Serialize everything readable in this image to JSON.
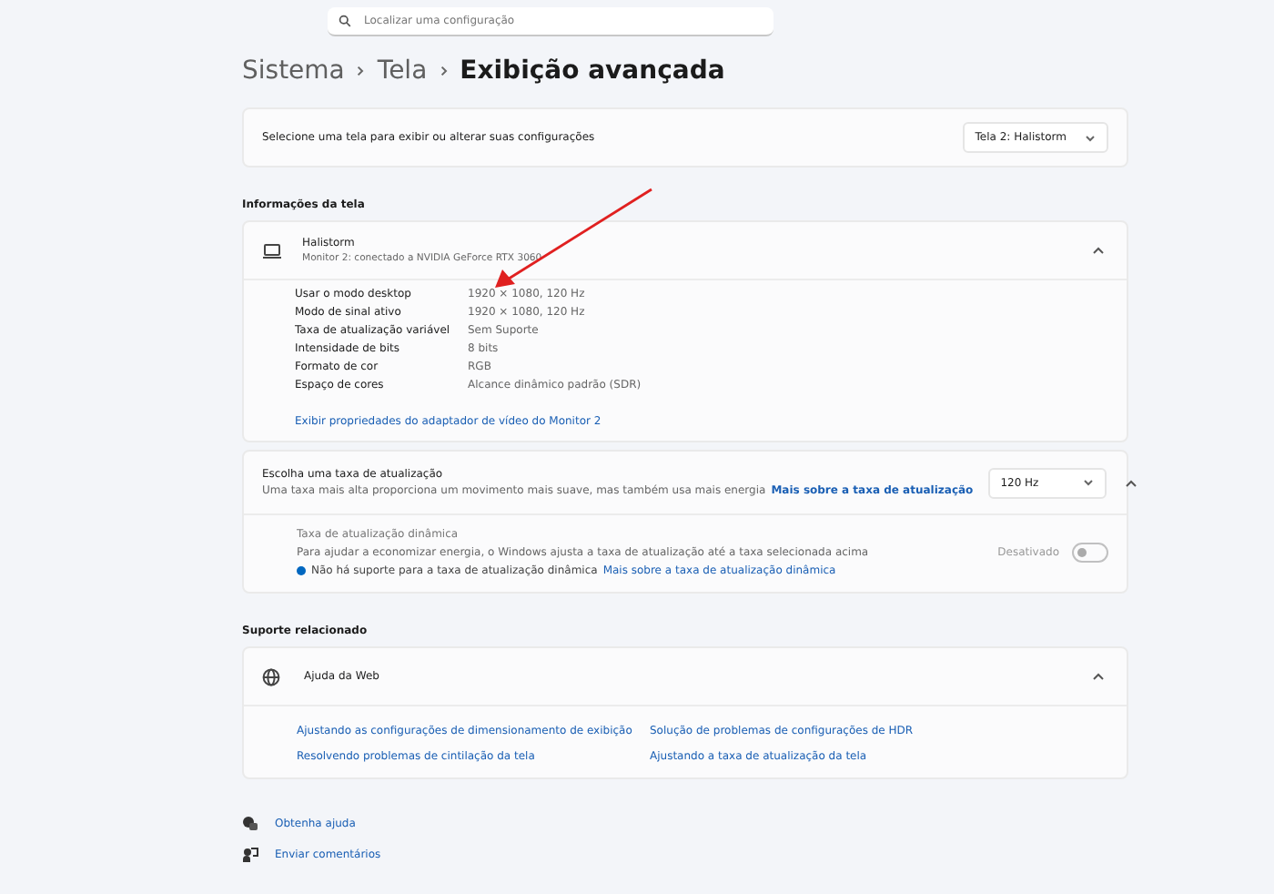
{
  "search": {
    "placeholder": "Localizar uma configuração"
  },
  "breadcrumb": [
    "Sistema",
    "Tela",
    "Exibição avançada"
  ],
  "select_display": {
    "label": "Selecione uma tela para exibir ou alterar suas configurações",
    "value": "Tela 2: Halistorm"
  },
  "display_info": {
    "heading": "Informações da tela",
    "name": "Halistorm",
    "subtitle": "Monitor 2: conectado a NVIDIA GeForce RTX 3060",
    "expanded": true,
    "rows": [
      {
        "label": "Usar o modo desktop",
        "value": "1920 × 1080, 120 Hz"
      },
      {
        "label": "Modo de sinal ativo",
        "value": "1920 × 1080, 120 Hz"
      },
      {
        "label": "Taxa de atualização variável",
        "value": "Sem Suporte"
      },
      {
        "label": "Intensidade de bits",
        "value": "8 bits"
      },
      {
        "label": "Formato de cor",
        "value": "RGB"
      },
      {
        "label": "Espaço de cores",
        "value": "Alcance dinâmico padrão (SDR)"
      }
    ],
    "link": "Exibir propriedades do adaptador de vídeo do Monitor 2"
  },
  "refresh": {
    "title": "Escolha uma taxa de atualização",
    "description": "Uma taxa mais alta proporciona um movimento mais suave, mas também usa mais energia",
    "link": "Mais sobre a taxa de atualização",
    "value": "120 Hz",
    "expanded": true,
    "dynamic": {
      "title": "Taxa de atualização dinâmica",
      "description": "Para ajudar a economizar energia, o Windows ajusta a taxa de atualização até a taxa selecionada acima",
      "note": "Não há suporte para a taxa de atualização dinâmica",
      "note_link": "Mais sobre a taxa de atualização dinâmica",
      "toggle_label": "Desativado",
      "on": false,
      "disabled": true
    }
  },
  "support": {
    "heading": "Suporte relacionado",
    "title": "Ajuda da Web",
    "expanded": true,
    "links": [
      "Ajustando as configurações de dimensionamento de exibição",
      "Solução de problemas de configurações de HDR",
      "Resolvendo problemas de cintilação da tela",
      "Ajustando a taxa de atualização da tela"
    ]
  },
  "footer": [
    {
      "kind": "help",
      "label": "Obtenha ajuda"
    },
    {
      "kind": "feedback",
      "label": "Enviar comentários"
    }
  ]
}
